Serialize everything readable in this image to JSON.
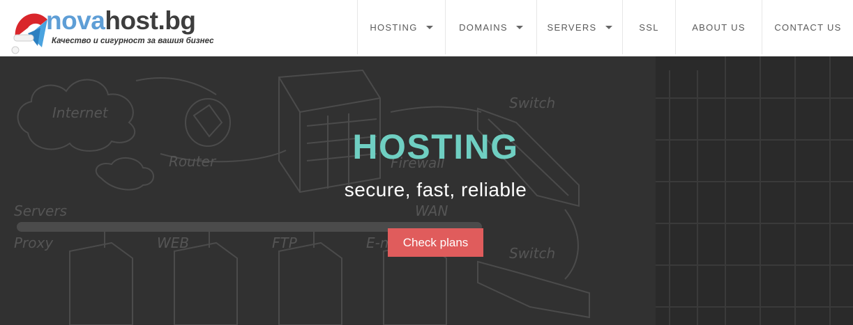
{
  "logo": {
    "brand_first": "nova",
    "brand_second": "host.bg",
    "tagline": "Качество и сигурност за вашия бизнес"
  },
  "nav": {
    "items": [
      {
        "label": "HOSTING",
        "has_dropdown": true
      },
      {
        "label": "DOMAINS",
        "has_dropdown": true
      },
      {
        "label": "SERVERS",
        "has_dropdown": true
      },
      {
        "label": "SSL",
        "has_dropdown": false
      },
      {
        "label": "ABOUT US",
        "has_dropdown": false
      },
      {
        "label": "CONTACT US",
        "has_dropdown": false
      }
    ]
  },
  "hero": {
    "title": "HOSTING",
    "subtitle": "secure, fast, reliable",
    "cta_label": "Check plans",
    "sketch_labels": {
      "internet": "Internet",
      "router": "Router",
      "firewall": "Firewall",
      "switch_top": "Switch",
      "switch_bottom": "Switch",
      "servers": "Servers",
      "wan": "WAN",
      "proxy": "Proxy",
      "web": "WEB",
      "ftp": "FTP",
      "email": "E-mail"
    }
  },
  "colors": {
    "hero_title": "#6fcfc2",
    "cta_background": "#e05c5c",
    "hero_background": "#313131",
    "brand_blue": "#5e9ed6"
  }
}
